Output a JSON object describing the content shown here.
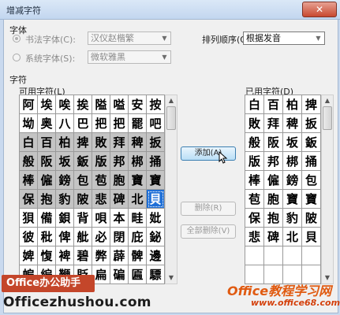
{
  "window": {
    "title": "增减字符",
    "close_glyph": "✕"
  },
  "font_group": {
    "title": "字体",
    "calligraphy_radio_label": "书法字体(C):",
    "calligraphy_value": "汉仪赵楷繁",
    "system_radio_label": "系统字体(S):",
    "system_value": "微软雅黑",
    "sort_label": "排列顺序(O):",
    "sort_value": "根据发音"
  },
  "chars_group": {
    "title": "字符",
    "available_label": "可用字符(L)",
    "used_label": "已用字符(D)",
    "available": [
      [
        "阿",
        "埃",
        "唉",
        "挨",
        "隘",
        "嗌",
        "安",
        "按"
      ],
      [
        "坳",
        "奥",
        "八",
        "巴",
        "把",
        "把",
        "罷",
        "吧"
      ],
      [
        "白",
        "百",
        "柏",
        "捭",
        "敗",
        "拜",
        "稗",
        "扳"
      ],
      [
        "般",
        "阪",
        "坂",
        "鈑",
        "版",
        "邦",
        "梆",
        "捅"
      ],
      [
        "棒",
        "僱",
        "鎊",
        "包",
        "苞",
        "胞",
        "寶",
        "寶"
      ],
      [
        "保",
        "抱",
        "豹",
        "陂",
        "悲",
        "碑",
        "北",
        "貝"
      ],
      [
        "狽",
        "備",
        "鋇",
        "背",
        "唄",
        "本",
        "畦",
        "妣"
      ],
      [
        "彼",
        "秕",
        "俾",
        "舭",
        "必",
        "閉",
        "庇",
        "鉍"
      ],
      [
        "婢",
        "愎",
        "裨",
        "碧",
        "弊",
        "薜",
        "髀",
        "邊"
      ],
      [
        "蝙",
        "編",
        "鞭",
        "貶",
        "扁",
        "碥",
        "匾",
        "驃"
      ]
    ],
    "used": [
      [
        "白",
        "百",
        "柏",
        "捭"
      ],
      [
        "敗",
        "拜",
        "稗",
        "扳"
      ],
      [
        "般",
        "阪",
        "坂",
        "鈑"
      ],
      [
        "版",
        "邦",
        "梆",
        "捅"
      ],
      [
        "棒",
        "僱",
        "鎊",
        "包"
      ],
      [
        "苞",
        "胞",
        "寶",
        "寶"
      ],
      [
        "保",
        "抱",
        "豹",
        "陂"
      ],
      [
        "悲",
        "碑",
        "北",
        "貝"
      ],
      [
        "",
        "",
        "",
        ""
      ],
      [
        "",
        "",
        "",
        ""
      ]
    ]
  },
  "buttons": {
    "add": "添加(A)",
    "remove": "删除(R)",
    "remove_all": "全部删除(V)"
  },
  "watermarks": {
    "brand": "Office办公助手",
    "brand_url": "Officezhushou.com",
    "site": "Office教程学习网",
    "site_url": "www.office68.com"
  }
}
